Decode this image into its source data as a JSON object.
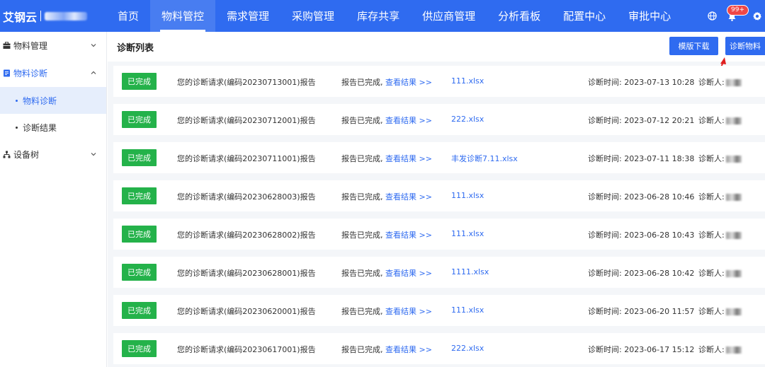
{
  "brand": {
    "name": "艾钢云"
  },
  "nav": {
    "items": [
      {
        "label": "首页",
        "active": false
      },
      {
        "label": "物料管控",
        "active": true
      },
      {
        "label": "需求管理",
        "active": false
      },
      {
        "label": "采购管理",
        "active": false
      },
      {
        "label": "库存共享",
        "active": false
      },
      {
        "label": "供应商管理",
        "active": false
      },
      {
        "label": "分析看板",
        "active": false
      },
      {
        "label": "配置中心",
        "active": false
      },
      {
        "label": "审批中心",
        "active": false
      }
    ],
    "notification_count": "99+"
  },
  "sidebar": {
    "material_mgmt": "物料管理",
    "material_diag": "物料诊断",
    "sub_diag": "物料诊断",
    "sub_result": "诊断结果",
    "device_tree": "设备树"
  },
  "main": {
    "title": "诊断列表",
    "template_button": "模版下载",
    "diagnose_button": "诊断物料"
  },
  "rows": [
    {
      "status": "已完成",
      "desc": "您的诊断请求(编码20230713001)报告",
      "done": "报告已完成,",
      "view": "查看结果 >>",
      "file": "111.xlsx",
      "time": "诊断时间: 2023-07-13 10:28",
      "person_label": "诊断人:"
    },
    {
      "status": "已完成",
      "desc": "您的诊断请求(编码20230712001)报告",
      "done": "报告已完成,",
      "view": "查看结果 >>",
      "file": "222.xlsx",
      "time": "诊断时间: 2023-07-12 20:21",
      "person_label": "诊断人:"
    },
    {
      "status": "已完成",
      "desc": "您的诊断请求(编码20230711001)报告",
      "done": "报告已完成,",
      "view": "查看结果 >>",
      "file": "丰发诊断7.11.xlsx",
      "time": "诊断时间: 2023-07-11 18:38",
      "person_label": "诊断人:"
    },
    {
      "status": "已完成",
      "desc": "您的诊断请求(编码20230628003)报告",
      "done": "报告已完成,",
      "view": "查看结果 >>",
      "file": "111.xlsx",
      "time": "诊断时间: 2023-06-28 10:46",
      "person_label": "诊断人:"
    },
    {
      "status": "已完成",
      "desc": "您的诊断请求(编码20230628002)报告",
      "done": "报告已完成,",
      "view": "查看结果 >>",
      "file": "111.xlsx",
      "time": "诊断时间: 2023-06-28 10:43",
      "person_label": "诊断人:"
    },
    {
      "status": "已完成",
      "desc": "您的诊断请求(编码20230628001)报告",
      "done": "报告已完成,",
      "view": "查看结果 >>",
      "file": "1111.xlsx",
      "time": "诊断时间: 2023-06-28 10:42",
      "person_label": "诊断人:"
    },
    {
      "status": "已完成",
      "desc": "您的诊断请求(编码20230620001)报告",
      "done": "报告已完成,",
      "view": "查看结果 >>",
      "file": "111.xlsx",
      "time": "诊断时间: 2023-06-20 11:57",
      "person_label": "诊断人:"
    },
    {
      "status": "已完成",
      "desc": "您的诊断请求(编码20230617001)报告",
      "done": "报告已完成,",
      "view": "查看结果 >>",
      "file": "222.xlsx",
      "time": "诊断时间: 2023-06-17 15:12",
      "person_label": "诊断人:"
    }
  ]
}
